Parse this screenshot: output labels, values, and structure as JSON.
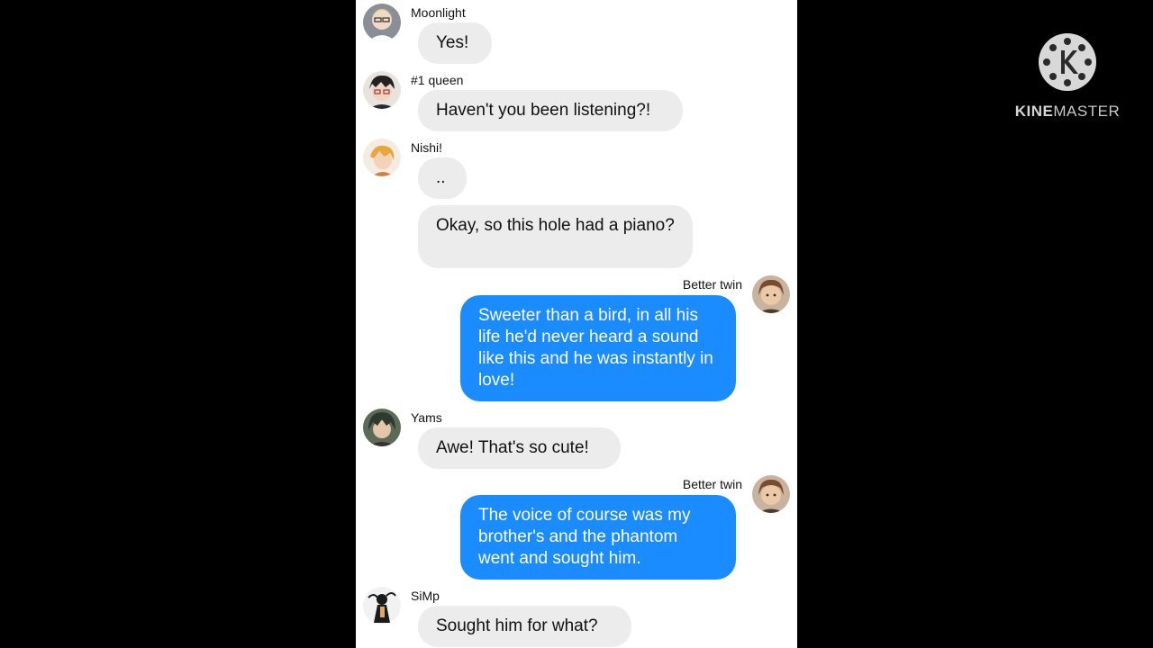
{
  "messages": [
    {
      "sender": "Moonlight",
      "avatar": "avatar-blonde-glasses",
      "side": "left",
      "text": "Yes!"
    },
    {
      "sender": "#1 queen",
      "avatar": "avatar-dark-hair-glasses",
      "side": "left",
      "text": "Haven't you been listening?!"
    },
    {
      "sender": "Nishi!",
      "avatar": "avatar-orange-hair",
      "side": "left",
      "text": ".."
    },
    {
      "sender": "",
      "avatar": "",
      "side": "left",
      "text": "Okay, so this hole had a piano?"
    },
    {
      "sender": "Better twin",
      "avatar": "avatar-brown-hair",
      "side": "right",
      "text": "Sweeter than a bird, in all his life he'd never heard a sound like this and he was instantly in love!"
    },
    {
      "sender": "Yams",
      "avatar": "avatar-dark-green-hair",
      "side": "left",
      "text": "Awe! That's so cute!"
    },
    {
      "sender": "Better twin",
      "avatar": "avatar-brown-hair",
      "side": "right",
      "text": "The voice of course was my brother's and the phantom went and sought him."
    },
    {
      "sender": "SiMp",
      "avatar": "avatar-black-white-figure",
      "side": "left",
      "text": "Sought him for what?"
    }
  ],
  "watermark": {
    "brand_bold": "KINE",
    "brand_thin": "MASTER",
    "icon": "kinemaster-k-icon"
  },
  "colors": {
    "incoming_bubble": "#ececec",
    "outgoing_bubble": "#1a8cff",
    "panel_bg": "#ffffff",
    "frame_bg": "#000000"
  }
}
